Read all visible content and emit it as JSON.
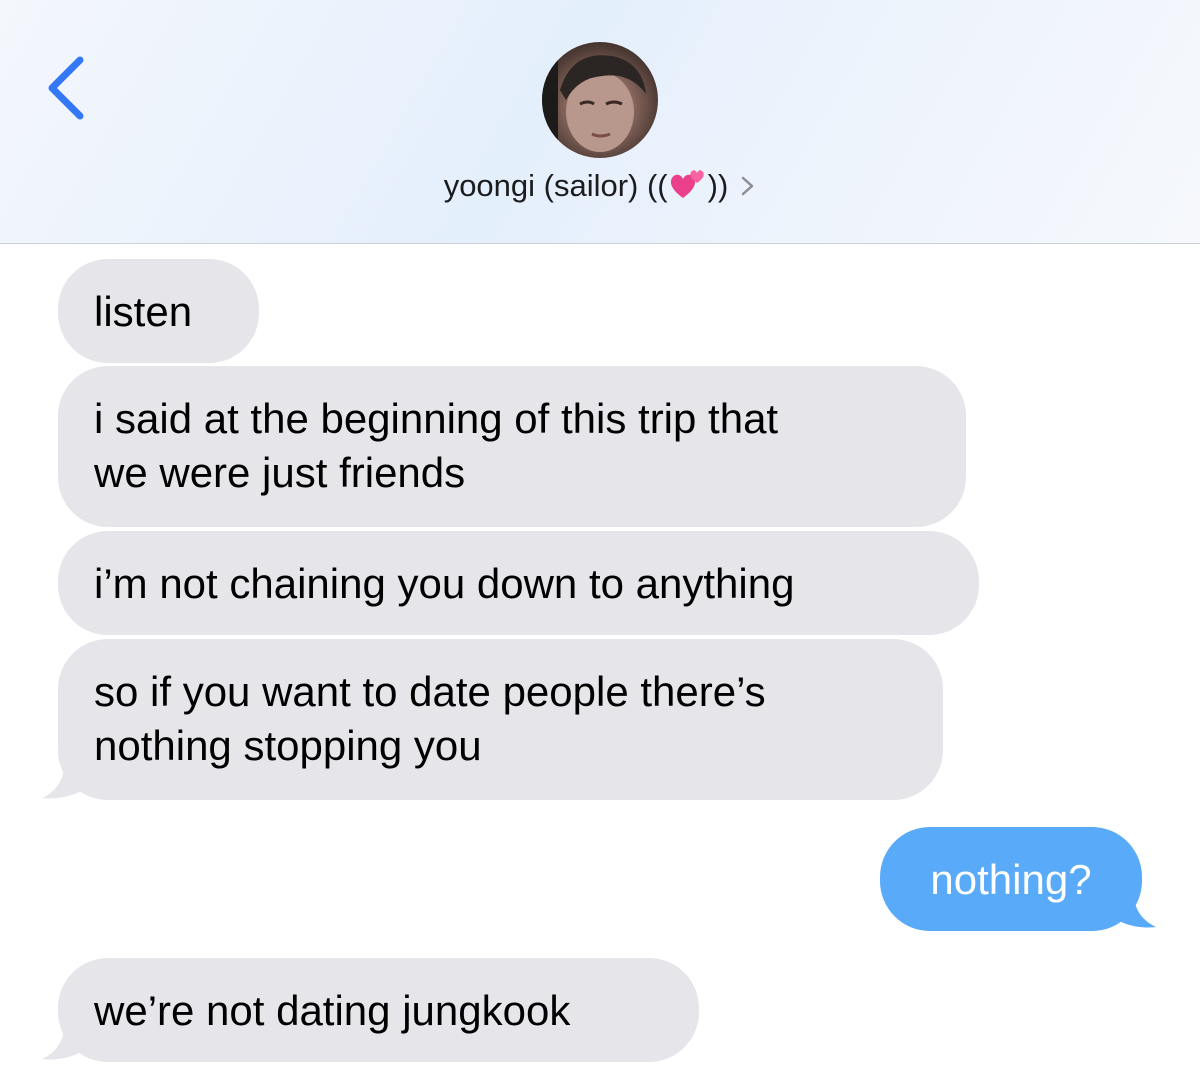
{
  "header": {
    "back_icon": "chevron-left-icon",
    "contact": {
      "name": "yoongi (sailor) ((",
      "name_suffix": "))",
      "emoji_icon": "two-hearts-icon",
      "chevron_icon": "chevron-right-icon"
    }
  },
  "messages": [
    {
      "direction": "incoming",
      "lines": [
        "listen"
      ]
    },
    {
      "direction": "incoming",
      "lines": [
        "i said at the beginning of this trip that",
        "we were just friends"
      ]
    },
    {
      "direction": "incoming",
      "lines": [
        "i’m not chaining you down to anything"
      ]
    },
    {
      "direction": "incoming",
      "lines": [
        "so if you want to date people there’s",
        "nothing stopping you"
      ]
    },
    {
      "direction": "outgoing",
      "lines": [
        "nothing?"
      ]
    },
    {
      "direction": "incoming",
      "lines": [
        "we’re not dating jungkook"
      ]
    }
  ],
  "colors": {
    "incoming_bubble": "#e5e5ea",
    "outgoing_bubble": "#59aaf8",
    "accent": "#3478f6"
  }
}
